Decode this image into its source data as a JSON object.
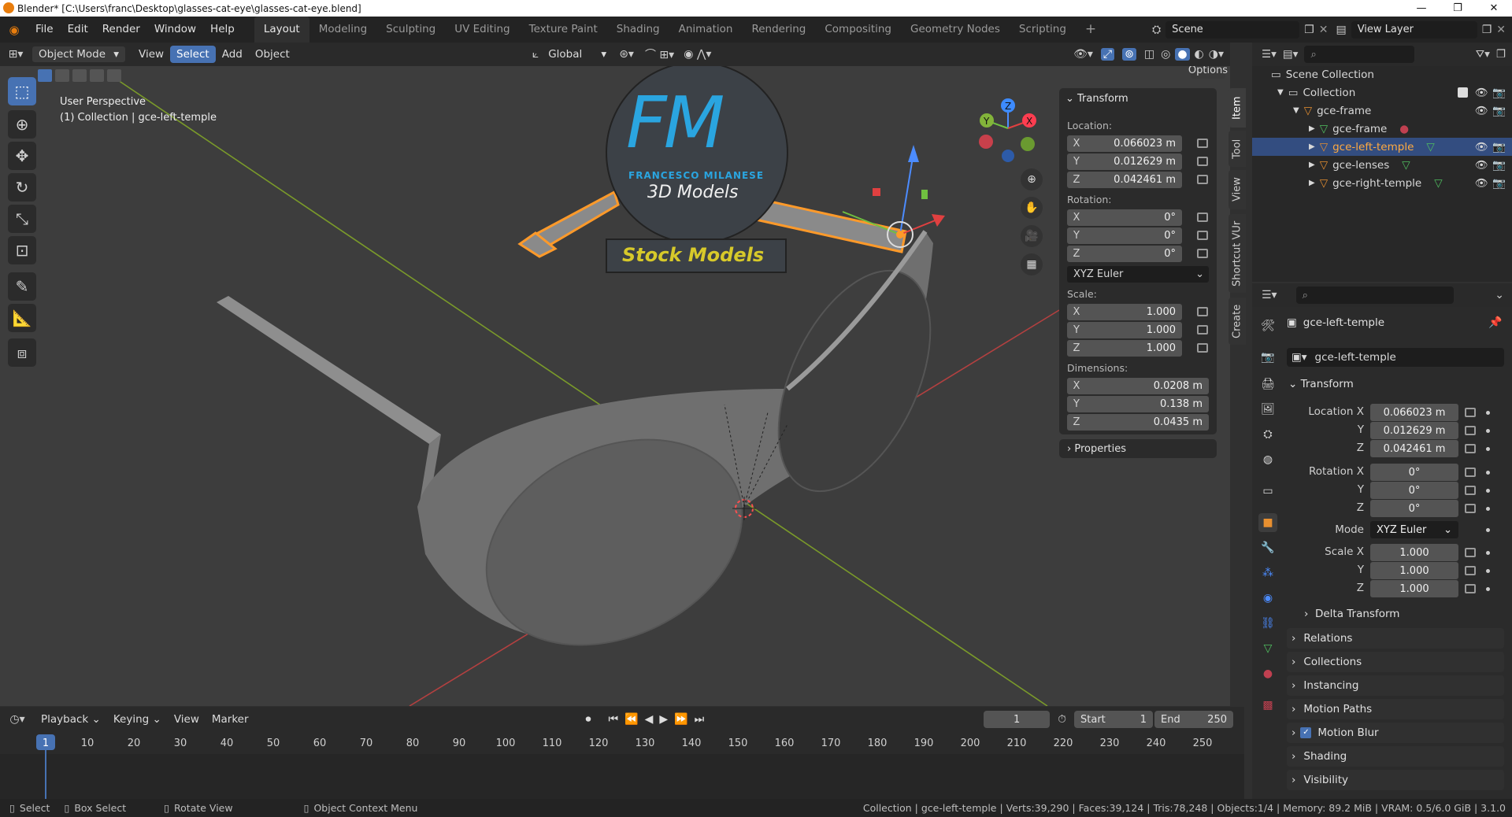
{
  "window": {
    "title": "Blender* [C:\\Users\\franc\\Desktop\\glasses-cat-eye\\glasses-cat-eye.blend]",
    "controls": [
      "—",
      "❐",
      "✕"
    ]
  },
  "menu": [
    "File",
    "Edit",
    "Render",
    "Window",
    "Help"
  ],
  "workspaces": [
    "Layout",
    "Modeling",
    "Sculpting",
    "UV Editing",
    "Texture Paint",
    "Shading",
    "Animation",
    "Rendering",
    "Compositing",
    "Geometry Nodes",
    "Scripting"
  ],
  "active_workspace": "Layout",
  "scene": "Scene",
  "view_layer": "View Layer",
  "viewport_header": {
    "mode": "Object Mode",
    "menus": [
      "View",
      "Select",
      "Add",
      "Object"
    ],
    "active_menu": "Select",
    "orientation": "Global",
    "options": "Options"
  },
  "viewport": {
    "perspective": "User Perspective",
    "context": "(1) Collection | gce-left-temple"
  },
  "watermark": {
    "letters": "FM",
    "name": "FRANCESCO MILANESE",
    "sub": "3D Models",
    "banner": "Stock Models"
  },
  "npanel": {
    "header": "Transform",
    "location_label": "Location:",
    "location": [
      {
        "axis": "X",
        "value": "0.066023 m"
      },
      {
        "axis": "Y",
        "value": "0.012629 m"
      },
      {
        "axis": "Z",
        "value": "0.042461 m"
      }
    ],
    "rotation_label": "Rotation:",
    "rotation": [
      {
        "axis": "X",
        "value": "0°"
      },
      {
        "axis": "Y",
        "value": "0°"
      },
      {
        "axis": "Z",
        "value": "0°"
      }
    ],
    "rotation_mode": "XYZ Euler",
    "scale_label": "Scale:",
    "scale": [
      {
        "axis": "X",
        "value": "1.000"
      },
      {
        "axis": "Y",
        "value": "1.000"
      },
      {
        "axis": "Z",
        "value": "1.000"
      }
    ],
    "dimensions_label": "Dimensions:",
    "dimensions": [
      {
        "axis": "X",
        "value": "0.0208 m"
      },
      {
        "axis": "Y",
        "value": "0.138 m"
      },
      {
        "axis": "Z",
        "value": "0.0435 m"
      }
    ],
    "properties": "Properties",
    "tabs": [
      "Item",
      "Tool",
      "View",
      "Shortcut VUr",
      "Create"
    ]
  },
  "outliner": {
    "rows": [
      {
        "label": "Scene Collection",
        "level": 0
      },
      {
        "label": "Collection",
        "level": 1
      },
      {
        "label": "gce-frame",
        "level": 2
      },
      {
        "label": "gce-frame",
        "level": 3
      },
      {
        "label": "gce-left-temple",
        "level": 3
      },
      {
        "label": "gce-lenses",
        "level": 3
      },
      {
        "label": "gce-right-temple",
        "level": 3
      }
    ]
  },
  "properties": {
    "object_name": "gce-left-temple",
    "data_name": "gce-left-temple",
    "transform": "Transform",
    "location_x_label": "Location X",
    "y_label": "Y",
    "z_label": "Z",
    "rotation_x_label": "Rotation X",
    "scale_x_label": "Scale X",
    "mode_label": "Mode",
    "location": [
      "0.066023 m",
      "0.012629 m",
      "0.042461 m"
    ],
    "rotation": [
      "0°",
      "0°",
      "0°"
    ],
    "mode": "XYZ Euler",
    "scale": [
      "1.000",
      "1.000",
      "1.000"
    ],
    "delta": "Delta Transform",
    "sections": [
      "Relations",
      "Collections",
      "Instancing",
      "Motion Paths",
      "Motion Blur",
      "Shading",
      "Visibility"
    ]
  },
  "timeline": {
    "menus": [
      "Playback",
      "Keying",
      "View",
      "Marker"
    ],
    "current_frame": "1",
    "start_label": "Start",
    "start": "1",
    "end_label": "End",
    "end": "250",
    "ticks": [
      "1",
      "10",
      "20",
      "30",
      "40",
      "50",
      "60",
      "70",
      "80",
      "90",
      "100",
      "110",
      "120",
      "130",
      "140",
      "150",
      "160",
      "170",
      "180",
      "190",
      "200",
      "210",
      "220",
      "230",
      "240",
      "250"
    ]
  },
  "status": {
    "hints": [
      "Select",
      "Box Select",
      "Rotate View",
      "Object Context Menu"
    ],
    "info": "Collection | gce-left-temple | Verts:39,290 | Faces:39,124 | Tris:78,248 | Objects:1/4 | Memory: 89.2 MiB | VRAM: 0.5/6.0 GiB | 3.1.0"
  }
}
